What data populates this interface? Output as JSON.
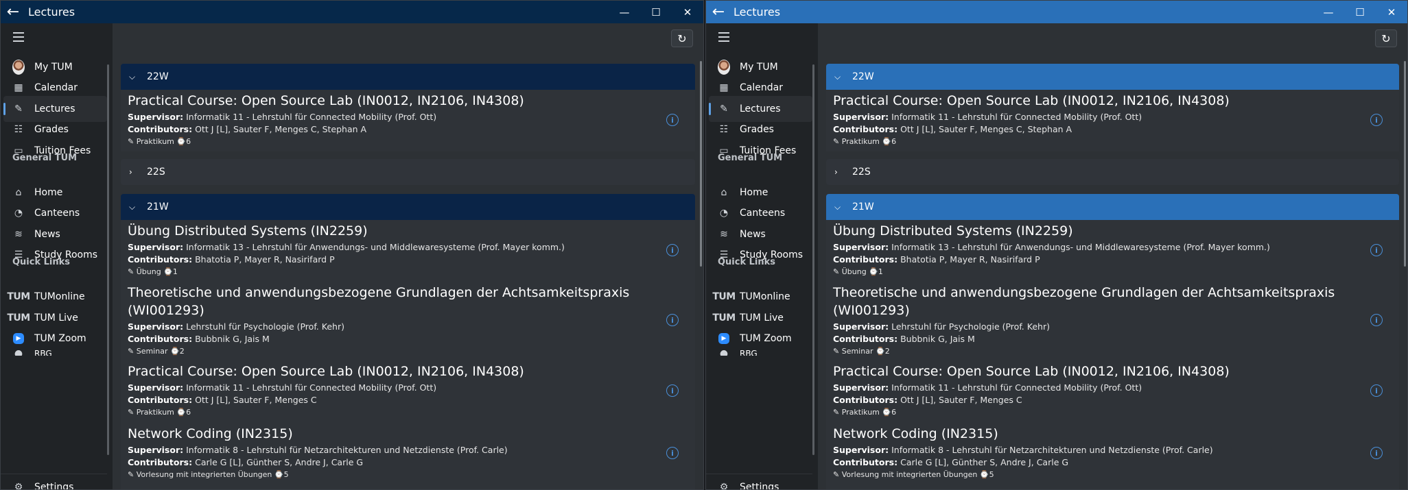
{
  "window": {
    "title": "Lectures",
    "minimize": "—",
    "maximize": "☐",
    "close": "✕"
  },
  "nav": {
    "my_tum": "My TUM",
    "calendar": "Calendar",
    "lectures": "Lectures",
    "grades": "Grades",
    "tuition_fees": "Tuition Fees",
    "general_header": "General TUM",
    "home": "Home",
    "canteens": "Canteens",
    "news": "News",
    "study_rooms": "Study Rooms",
    "quick_links_header": "Quick Links",
    "tumonline": "TUMonline",
    "tum_live": "TUM Live",
    "tum_zoom": "TUM Zoom",
    "rbg": "RBG",
    "settings": "Settings",
    "tum_logo_text": "TUM"
  },
  "groups": {
    "g22w": "22W",
    "g22s": "22S",
    "g21w": "21W"
  },
  "lectures": [
    {
      "title": "Practical Course: Open Source Lab (IN0012, IN2106, IN4308)",
      "supervisor_label": "Supervisor:",
      "supervisor": "Informatik 11 - Lehrstuhl für Connected Mobility (Prof. Ott)",
      "contributors_label": "Contributors:",
      "contributors": "Ott J [L], Sauter F, Menges C, Stephan A",
      "type": "Praktikum",
      "sws": "6"
    },
    {
      "title": "Übung Distributed Systems (IN2259)",
      "supervisor_label": "Supervisor:",
      "supervisor": "Informatik 13 - Lehrstuhl für Anwendungs- und Middlewaresysteme (Prof. Mayer komm.)",
      "contributors_label": "Contributors:",
      "contributors": "Bhatotia P, Mayer R, Nasirifard P",
      "type": "Übung",
      "sws": "1"
    },
    {
      "title_line1": "Theoretische und anwendungsbezogene Grundlagen der Achtsamkeitspraxis",
      "title_line2": "(WI001293)",
      "supervisor_label": "Supervisor:",
      "supervisor": "Lehrstuhl für Psychologie (Prof. Kehr)",
      "contributors_label": "Contributors:",
      "contributors": "Bubbnik G, Jais M",
      "type": "Seminar",
      "sws": "2"
    },
    {
      "title": "Practical Course: Open Source Lab (IN0012, IN2106, IN4308)",
      "supervisor_label": "Supervisor:",
      "supervisor": "Informatik 11 - Lehrstuhl für Connected Mobility (Prof. Ott)",
      "contributors_label": "Contributors:",
      "contributors": "Ott J [L], Sauter F, Menges C",
      "type": "Praktikum",
      "sws": "6"
    },
    {
      "title": "Network Coding (IN2315)",
      "supervisor_label": "Supervisor:",
      "supervisor": "Informatik 8 - Lehrstuhl für Netzarchitekturen und Netzdienste (Prof. Carle)",
      "contributors_label": "Contributors:",
      "contributors": "Carle G [L], Günther S, Andre J, Carle G",
      "type": "Vorlesung mit integrierten Übungen",
      "sws": "5"
    }
  ],
  "colors": {
    "left_accent": "#06284a",
    "right_accent": "#2a70b8",
    "info_icon": "#4a8fd8"
  }
}
